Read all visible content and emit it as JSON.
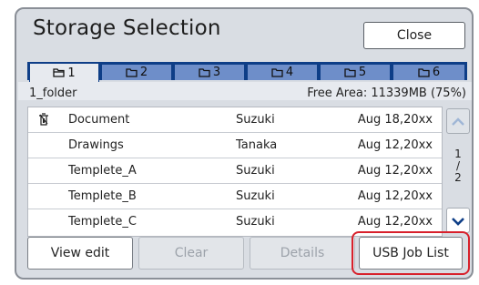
{
  "window": {
    "title": "Storage Selection",
    "close_label": "Close"
  },
  "tabs": [
    {
      "label": "1",
      "active": true
    },
    {
      "label": "2",
      "active": false
    },
    {
      "label": "3",
      "active": false
    },
    {
      "label": "4",
      "active": false
    },
    {
      "label": "5",
      "active": false
    },
    {
      "label": "6",
      "active": false
    }
  ],
  "folder": {
    "name": "1_folder",
    "free_area": "Free Area: 11339MB (75%)"
  },
  "files": [
    {
      "icon": "protected-document-icon",
      "name": "Document",
      "owner": "Suzuki",
      "date": "Aug 18,20xx"
    },
    {
      "icon": "",
      "name": "Drawings",
      "owner": "Tanaka",
      "date": "Aug 12,20xx"
    },
    {
      "icon": "",
      "name": "Templete_A",
      "owner": "Suzuki",
      "date": "Aug 12,20xx"
    },
    {
      "icon": "",
      "name": "Templete_B",
      "owner": "Suzuki",
      "date": "Aug 12,20xx"
    },
    {
      "icon": "",
      "name": "Templete_C",
      "owner": "Suzuki",
      "date": "Aug 12,20xx"
    }
  ],
  "pagination": {
    "current": "1",
    "separator": "/",
    "total": "2"
  },
  "buttons": {
    "view_edit": "View edit",
    "clear": "Clear",
    "details": "Details",
    "usb_job_list": "USB Job List"
  },
  "colors": {
    "tab_bar": "#0e3e87",
    "tab_inactive": "#6e8ec9",
    "highlight": "#d8202b",
    "panel_bg": "#d9dde3"
  }
}
